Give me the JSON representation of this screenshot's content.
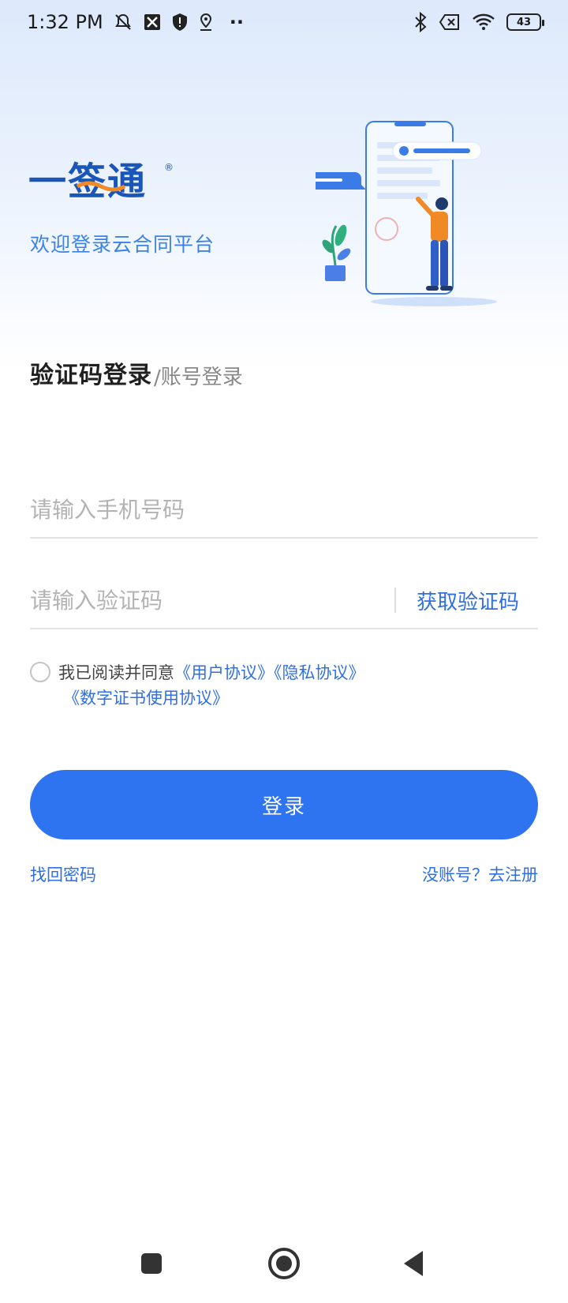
{
  "status": {
    "time": "1:32 PM",
    "dots": "··",
    "battery": "43"
  },
  "brand": {
    "logo_text": "一签通",
    "registered_mark": "®",
    "welcome": "欢迎登录云合同平台"
  },
  "tabs": {
    "active": "验证码登录",
    "separator": "/",
    "inactive": "账号登录"
  },
  "form": {
    "phone_placeholder": "请输入手机号码",
    "code_placeholder": "请输入验证码",
    "get_code": "获取验证码"
  },
  "agreement": {
    "prefix": "我已阅读并同意",
    "user_agreement": "《用户协议》",
    "privacy_agreement": "《隐私协议》",
    "certificate_agreement": "《数字证书使用协议》"
  },
  "actions": {
    "login": "登录",
    "forgot": "找回密码",
    "register": "没账号？去注册"
  },
  "colors": {
    "primary": "#2e73f0",
    "link": "#2f6fe3",
    "accent_orange": "#f08a24"
  },
  "icons": [
    "mute-icon",
    "no-sim-icon",
    "shield-icon",
    "location-icon",
    "bluetooth-icon",
    "sim-x-icon",
    "wifi-icon",
    "battery-icon",
    "recents-icon",
    "home-icon",
    "back-icon"
  ]
}
